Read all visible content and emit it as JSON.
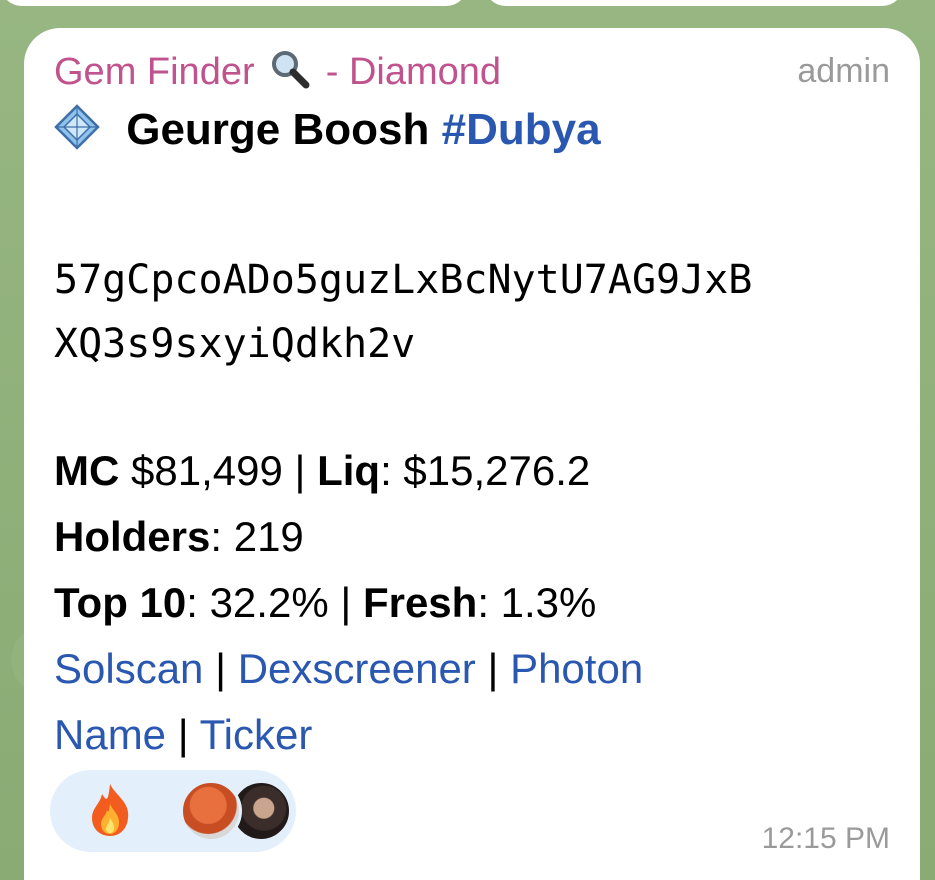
{
  "message": {
    "sender": "Gem Finder",
    "sender_suffix": "- Diamond",
    "sender_icon": "magnifying-glass-icon",
    "role": "admin",
    "title_icon": "diamond-icon",
    "title": "Geurge Boosh",
    "hashtag": "#Dubya",
    "contract_line1": "57gCpcoADo5guzLxBcNytU7AG9JxB",
    "contract_line2": "XQ3s9sxyiQdkh2v",
    "mc_label": "MC",
    "mc_value": "$81,499",
    "liq_label": "Liq",
    "liq_value": "$15,276.2",
    "holders_label": "Holders",
    "holders_value": "219",
    "top10_label": "Top 10",
    "top10_value": "32.2%",
    "fresh_label": "Fresh",
    "fresh_value": "1.3%",
    "links_row1": [
      "Solscan",
      "Dexscreener",
      "Photon"
    ],
    "links_row2": [
      "Name",
      "Ticker"
    ],
    "separator": "|",
    "reaction_icon": "fire-emoji-icon",
    "time": "12:15 PM"
  },
  "colors": {
    "sender": "#c0538e",
    "link": "#2a58b0",
    "meta": "#9a9a9a",
    "reaction_bg": "#e3effb"
  }
}
